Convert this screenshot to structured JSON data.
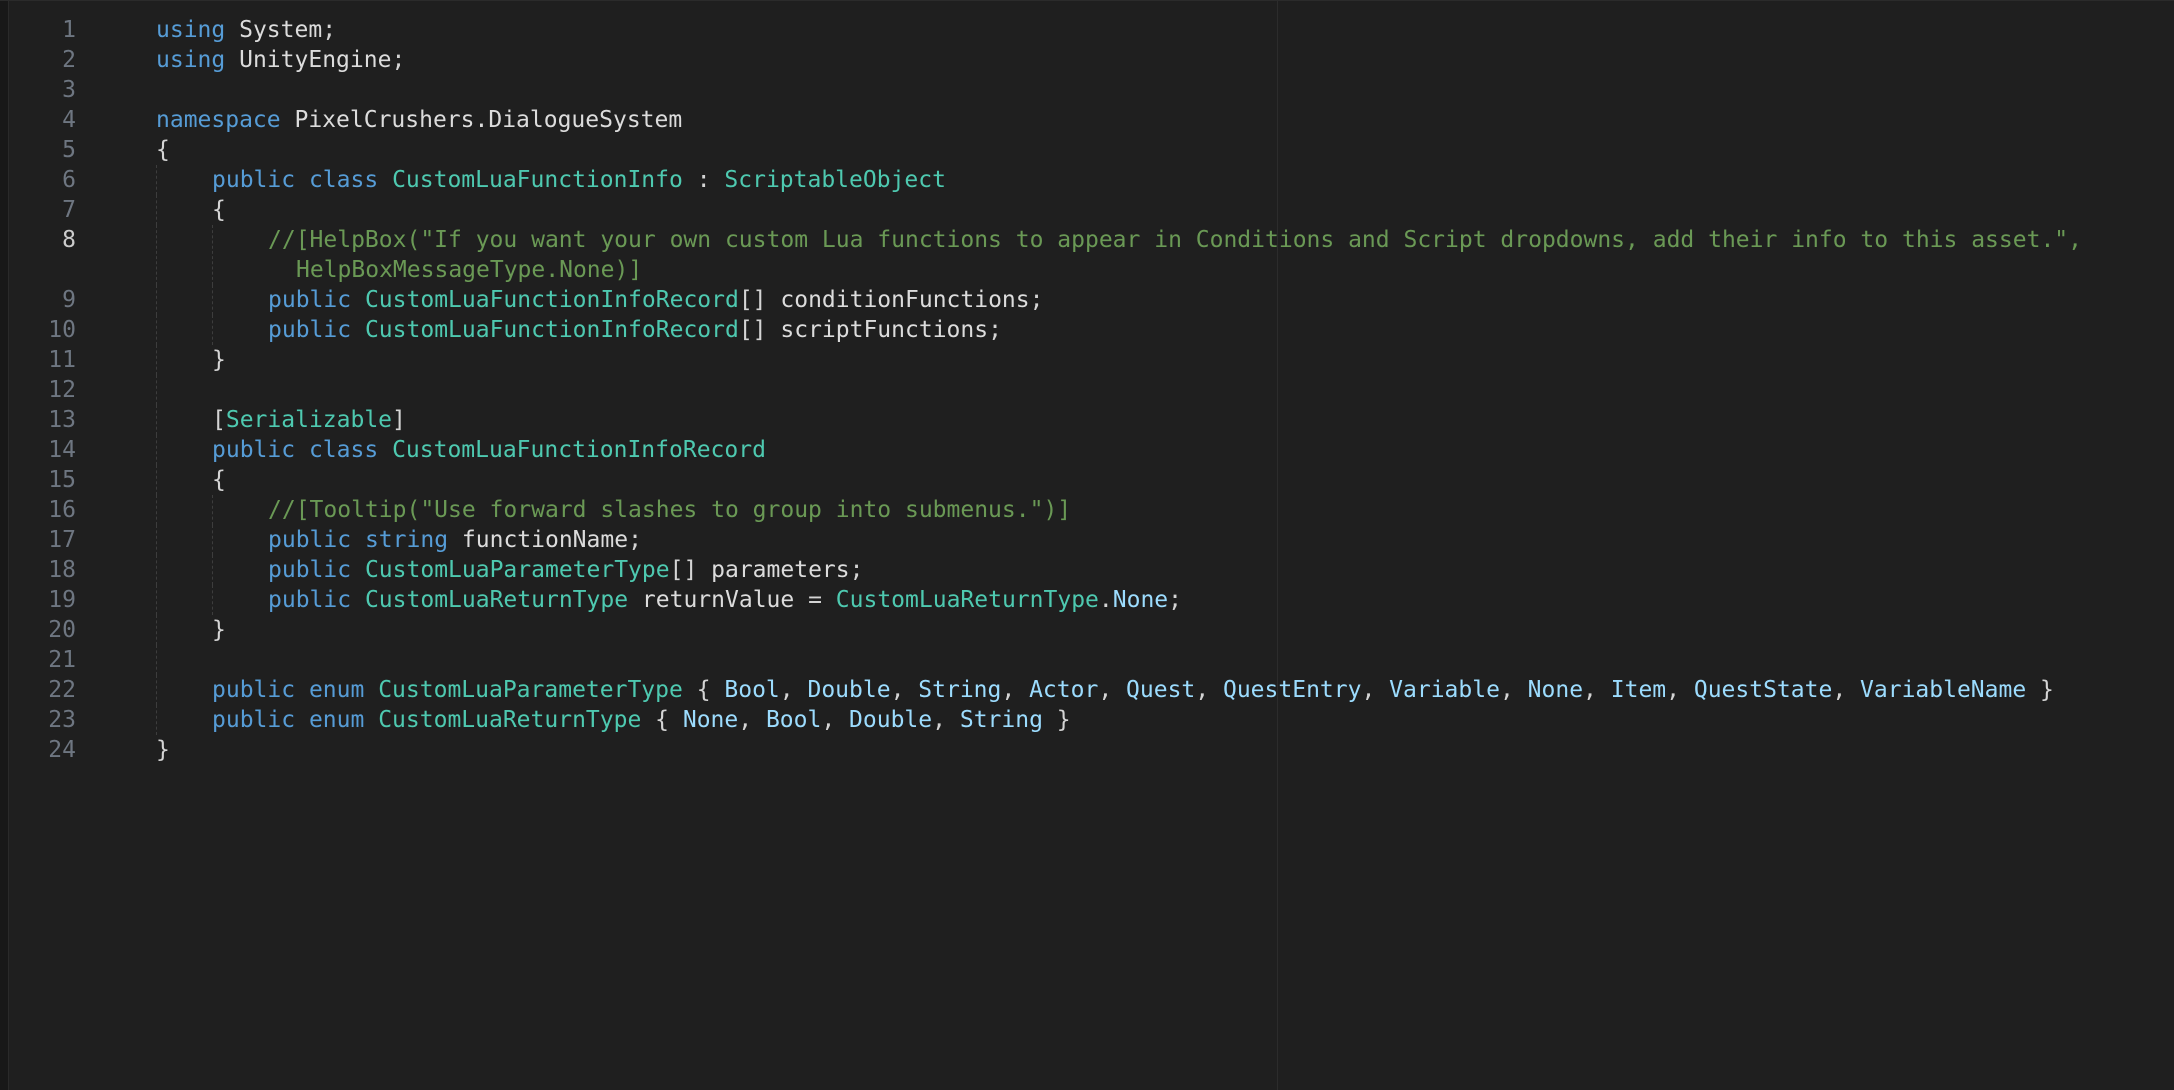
{
  "editor": {
    "lines": [
      {
        "n": "1",
        "tokens": [
          [
            "kw",
            "using"
          ],
          [
            "pr",
            " "
          ],
          [
            "id",
            "System"
          ],
          [
            "pr",
            ";"
          ]
        ]
      },
      {
        "n": "2",
        "tokens": [
          [
            "kw",
            "using"
          ],
          [
            "pr",
            " "
          ],
          [
            "id",
            "UnityEngine"
          ],
          [
            "pr",
            ";"
          ]
        ]
      },
      {
        "n": "3",
        "tokens": []
      },
      {
        "n": "4",
        "tokens": [
          [
            "kw",
            "namespace"
          ],
          [
            "pr",
            " "
          ],
          [
            "id",
            "PixelCrushers.DialogueSystem"
          ]
        ]
      },
      {
        "n": "5",
        "tokens": [
          [
            "pr",
            "{"
          ]
        ]
      },
      {
        "n": "6",
        "indent": 1,
        "tokens": [
          [
            "kw",
            "public"
          ],
          [
            "pr",
            " "
          ],
          [
            "kw",
            "class"
          ],
          [
            "pr",
            " "
          ],
          [
            "ty",
            "CustomLuaFunctionInfo"
          ],
          [
            "pr",
            " : "
          ],
          [
            "ty",
            "ScriptableObject"
          ]
        ]
      },
      {
        "n": "7",
        "indent": 1,
        "tokens": [
          [
            "pr",
            "{"
          ]
        ]
      },
      {
        "n": "8",
        "indent": 2,
        "active": true,
        "tokens": [
          [
            "cm",
            "//[HelpBox(\"If you want your own custom Lua functions to appear in Conditions and Script dropdowns, add their info to this asset.\","
          ]
        ],
        "continuation": [
          [
            "cm",
            "HelpBoxMessageType.None)]"
          ]
        ]
      },
      {
        "n": "9",
        "indent": 2,
        "tokens": [
          [
            "kw",
            "public"
          ],
          [
            "pr",
            " "
          ],
          [
            "ty",
            "CustomLuaFunctionInfoRecord"
          ],
          [
            "pr",
            "[] "
          ],
          [
            "id",
            "conditionFunctions"
          ],
          [
            "pr",
            ";"
          ]
        ]
      },
      {
        "n": "10",
        "indent": 2,
        "tokens": [
          [
            "kw",
            "public"
          ],
          [
            "pr",
            " "
          ],
          [
            "ty",
            "CustomLuaFunctionInfoRecord"
          ],
          [
            "pr",
            "[] "
          ],
          [
            "id",
            "scriptFunctions"
          ],
          [
            "pr",
            ";"
          ]
        ]
      },
      {
        "n": "11",
        "indent": 1,
        "tokens": [
          [
            "pr",
            "}"
          ]
        ]
      },
      {
        "n": "12",
        "tokens": []
      },
      {
        "n": "13",
        "indent": 1,
        "tokens": [
          [
            "pr",
            "["
          ],
          [
            "ty",
            "Serializable"
          ],
          [
            "pr",
            "]"
          ]
        ]
      },
      {
        "n": "14",
        "indent": 1,
        "tokens": [
          [
            "kw",
            "public"
          ],
          [
            "pr",
            " "
          ],
          [
            "kw",
            "class"
          ],
          [
            "pr",
            " "
          ],
          [
            "ty",
            "CustomLuaFunctionInfoRecord"
          ]
        ]
      },
      {
        "n": "15",
        "indent": 1,
        "tokens": [
          [
            "pr",
            "{"
          ]
        ]
      },
      {
        "n": "16",
        "indent": 2,
        "tokens": [
          [
            "cm",
            "//[Tooltip(\"Use forward slashes to group into submenus.\")]"
          ]
        ]
      },
      {
        "n": "17",
        "indent": 2,
        "tokens": [
          [
            "kw",
            "public"
          ],
          [
            "pr",
            " "
          ],
          [
            "kw",
            "string"
          ],
          [
            "pr",
            " "
          ],
          [
            "id",
            "functionName"
          ],
          [
            "pr",
            ";"
          ]
        ]
      },
      {
        "n": "18",
        "indent": 2,
        "tokens": [
          [
            "kw",
            "public"
          ],
          [
            "pr",
            " "
          ],
          [
            "ty",
            "CustomLuaParameterType"
          ],
          [
            "pr",
            "[] "
          ],
          [
            "id",
            "parameters"
          ],
          [
            "pr",
            ";"
          ]
        ]
      },
      {
        "n": "19",
        "indent": 2,
        "tokens": [
          [
            "kw",
            "public"
          ],
          [
            "pr",
            " "
          ],
          [
            "ty",
            "CustomLuaReturnType"
          ],
          [
            "pr",
            " "
          ],
          [
            "id",
            "returnValue"
          ],
          [
            "pr",
            " = "
          ],
          [
            "ty",
            "CustomLuaReturnType"
          ],
          [
            "pr",
            "."
          ],
          [
            "em",
            "None"
          ],
          [
            "pr",
            ";"
          ]
        ]
      },
      {
        "n": "20",
        "indent": 1,
        "tokens": [
          [
            "pr",
            "}"
          ]
        ]
      },
      {
        "n": "21",
        "tokens": []
      },
      {
        "n": "22",
        "indent": 1,
        "tokens": [
          [
            "kw",
            "public"
          ],
          [
            "pr",
            " "
          ],
          [
            "kw",
            "enum"
          ],
          [
            "pr",
            " "
          ],
          [
            "ty",
            "CustomLuaParameterType"
          ],
          [
            "pr",
            " { "
          ],
          [
            "em",
            "Bool"
          ],
          [
            "pr",
            ", "
          ],
          [
            "em",
            "Double"
          ],
          [
            "pr",
            ", "
          ],
          [
            "em",
            "String"
          ],
          [
            "pr",
            ", "
          ],
          [
            "em",
            "Actor"
          ],
          [
            "pr",
            ", "
          ],
          [
            "em",
            "Quest"
          ],
          [
            "pr",
            ", "
          ],
          [
            "em",
            "QuestEntry"
          ],
          [
            "pr",
            ", "
          ],
          [
            "em",
            "Variable"
          ],
          [
            "pr",
            ", "
          ],
          [
            "em",
            "None"
          ],
          [
            "pr",
            ", "
          ],
          [
            "em",
            "Item"
          ],
          [
            "pr",
            ", "
          ],
          [
            "em",
            "QuestState"
          ],
          [
            "pr",
            ", "
          ],
          [
            "em",
            "VariableName"
          ],
          [
            "pr",
            " }"
          ]
        ]
      },
      {
        "n": "23",
        "indent": 1,
        "tokens": [
          [
            "kw",
            "public"
          ],
          [
            "pr",
            " "
          ],
          [
            "kw",
            "enum"
          ],
          [
            "pr",
            " "
          ],
          [
            "ty",
            "CustomLuaReturnType"
          ],
          [
            "pr",
            " { "
          ],
          [
            "em",
            "None"
          ],
          [
            "pr",
            ", "
          ],
          [
            "em",
            "Bool"
          ],
          [
            "pr",
            ", "
          ],
          [
            "em",
            "Double"
          ],
          [
            "pr",
            ", "
          ],
          [
            "em",
            "String"
          ],
          [
            "pr",
            " }"
          ]
        ]
      },
      {
        "n": "24",
        "tokens": [
          [
            "pr",
            "}"
          ]
        ]
      }
    ]
  }
}
